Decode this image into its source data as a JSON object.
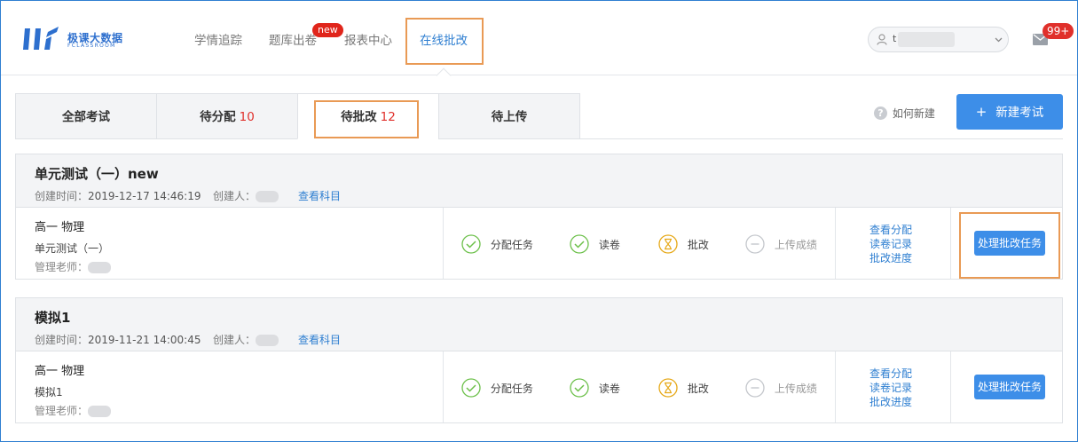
{
  "brand": {
    "name": "极课大数据",
    "sub": "FCLASSROOM",
    "color": "#2d6fce"
  },
  "nav": {
    "items": [
      {
        "label": "学情追踪"
      },
      {
        "label": "题库出卷",
        "badge": "new"
      },
      {
        "label": "报表中心"
      },
      {
        "label": "在线批改",
        "active": true
      }
    ]
  },
  "user": {
    "name_initial": "t",
    "icon": "user-icon"
  },
  "mail": {
    "icon": "mail-icon",
    "badge": "99+"
  },
  "tabs": [
    {
      "label": "全部考试",
      "count": ""
    },
    {
      "label": "待分配",
      "count": "10"
    },
    {
      "label": "待批改",
      "count": "12",
      "active": true
    },
    {
      "label": "待上传",
      "count": ""
    }
  ],
  "help": {
    "icon": "question-icon",
    "label": "如何新建"
  },
  "new_exam_button": {
    "plus": "+",
    "label": "新建考试"
  },
  "exams": [
    {
      "title": "单元测试（一）new",
      "created_label": "创建时间：",
      "created_time": "2019-12-17 14:46:19",
      "creator_label": "创建人：",
      "view_subjects": "查看科目",
      "grade_subject": "高一 物理",
      "exam_name": "单元测试（一）",
      "teacher_label": "管理老师：",
      "steps": [
        {
          "label": "分配任务",
          "state": "done",
          "icon": "check-circle-icon"
        },
        {
          "label": "读卷",
          "state": "done",
          "icon": "check-circle-icon"
        },
        {
          "label": "批改",
          "state": "in-progress",
          "icon": "hourglass-icon"
        },
        {
          "label": "上传成绩",
          "state": "pending",
          "icon": "minus-circle-icon"
        }
      ],
      "links": [
        "查看分配",
        "读卷记录",
        "批改进度"
      ],
      "action": "处理批改任务"
    },
    {
      "title": "模拟1",
      "created_label": "创建时间：",
      "created_time": "2019-11-21 14:00:45",
      "creator_label": "创建人：",
      "view_subjects": "查看科目",
      "grade_subject": "高一 物理",
      "exam_name": "模拟1",
      "teacher_label": "管理老师：",
      "steps": [
        {
          "label": "分配任务",
          "state": "done",
          "icon": "check-circle-icon"
        },
        {
          "label": "读卷",
          "state": "done",
          "icon": "check-circle-icon"
        },
        {
          "label": "批改",
          "state": "in-progress",
          "icon": "hourglass-icon"
        },
        {
          "label": "上传成绩",
          "state": "pending",
          "icon": "minus-circle-icon"
        }
      ],
      "links": [
        "查看分配",
        "读卷记录",
        "批改进度"
      ],
      "action": "处理批改任务"
    }
  ],
  "colors": {
    "primary": "#3d8ee8",
    "link": "#2f7fd1",
    "done": "#6cc04a",
    "in_progress": "#e6a817",
    "pending": "#c4c7cc",
    "badge": "#e0302b",
    "highlight": "#e99a55"
  }
}
